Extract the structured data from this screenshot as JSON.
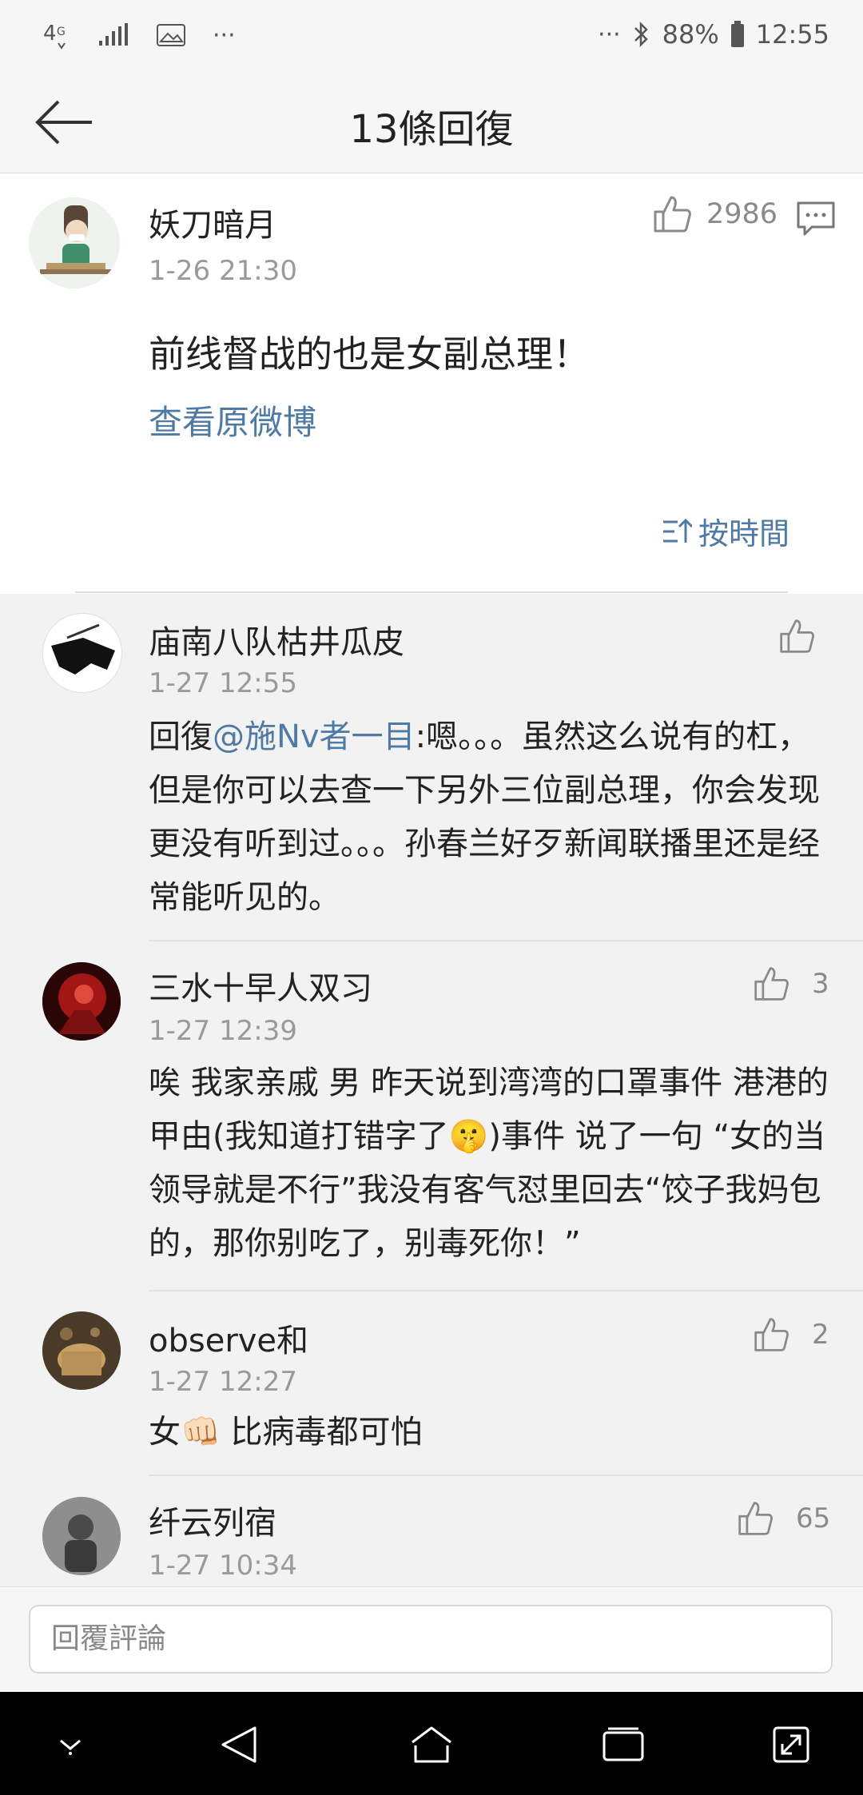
{
  "status_bar": {
    "network": "4G",
    "battery": "88%",
    "time": "12:55"
  },
  "header": {
    "title": "13條回復"
  },
  "main_post": {
    "username": "妖刀暗月",
    "time": "1-26 21:30",
    "likes": "2986",
    "text": "前线督战的也是女副总理！",
    "view_original": "查看原微博",
    "sort_label": "按時間"
  },
  "comments": [
    {
      "username": "庙南八队枯井瓜皮",
      "time": "1-27 12:55",
      "likes": "",
      "prefix": "回復",
      "mention": "@施Nv者一目",
      "text": ":嗯。。。虽然这么说有的杠，但是你可以去查一下另外三位副总理，你会发现更没有听到过。。。孙春兰好歹新闻联播里还是经常能听见的。"
    },
    {
      "username": "三水十早人双习",
      "time": "1-27 12:39",
      "likes": "3",
      "text_a": "唉 我家亲戚 男 昨天说到湾湾的口罩事件 港港的甲由(我知道打错字了",
      "emoji": "🤫",
      "text_b": ")事件  说了一句 “女的当领导就是不行”我没有客气怼里回去“饺子我妈包的，那你别吃了，别毒死你！”"
    },
    {
      "username": "observe和",
      "time": "1-27 12:27",
      "likes": "2",
      "text_a": "女",
      "emoji": "👊🏻",
      "text_b": " 比病毒都可怕"
    },
    {
      "username": "纤云列宿",
      "time": "1-27 10:34",
      "likes": "65"
    }
  ],
  "reply_bar": {
    "placeholder": "回覆評論"
  },
  "icons": {
    "back": "back-arrow-icon",
    "like": "thumbs-up-icon",
    "comment": "comment-icon",
    "sort": "sort-icon"
  },
  "colors": {
    "link": "#4f7aa4",
    "meta": "#9a9a9a",
    "background": "#f2f2f2"
  }
}
